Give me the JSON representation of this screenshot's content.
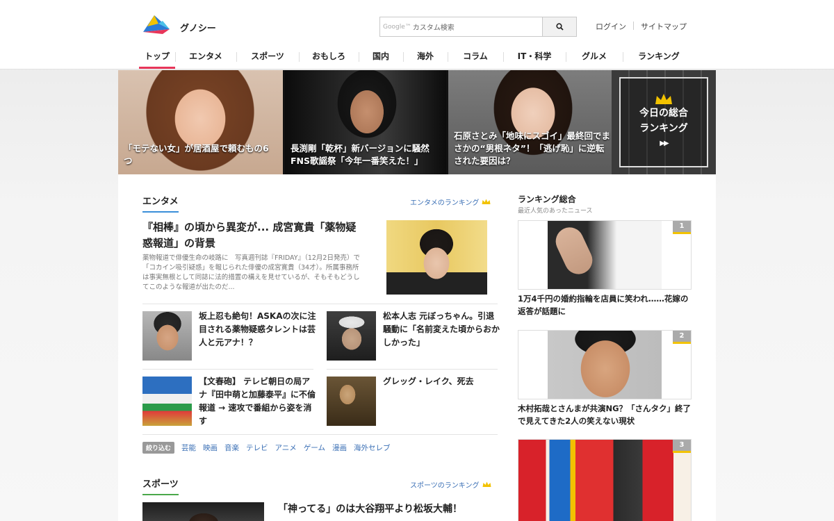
{
  "header": {
    "brand": "グノシー",
    "search_placeholder": "カスタム検索",
    "search_google_label": "Google™",
    "links": [
      "ログイン",
      "サイトマップ"
    ]
  },
  "nav": {
    "items": [
      "トップ",
      "エンタメ",
      "スポーツ",
      "おもしろ",
      "国内",
      "海外",
      "コラム",
      "IT・科学",
      "グルメ",
      "ランキング"
    ],
    "active": "トップ"
  },
  "hero": {
    "cards": [
      {
        "caption": "「モテない女」が居酒屋で頼むもの6つ"
      },
      {
        "caption": "長渕剛「乾杯」新バージョンに騒然 FNS歌謡祭「今年一番笑えた！」"
      },
      {
        "caption": "石原さとみ「地味にスゴイ」最終回でまさかの“男根ネタ”！「逃げ恥」に逆転された要因は？"
      }
    ],
    "ranking_box": {
      "line1": "今日の総合",
      "line2": "ランキング",
      "arrow": "▶▶"
    }
  },
  "entame": {
    "title": "エンタメ",
    "ranking_link": "エンタメのランキング",
    "main": {
      "headline": "『相棒』の頃から異変が... 成宮寛貴「薬物疑惑報道」の背景",
      "summary": "薬物報道で俳優生命の岐路に　写真週刊誌『FRIDAY』（12月2日発売）で「コカイン吸引疑惑」を報じられた俳優の成宮寛貴（34才）。所属事務所は事実無根として同誌に法的措置の構えを見せているが、そもそもどうしてこのような報道が出たのだ..."
    },
    "articles": [
      {
        "title": "坂上忍も絶句！ASKAの次に注目される薬物疑惑タレントは芸人と元アナ！？"
      },
      {
        "title": "松本人志 元ぼっちゃん。引退騒動に「名前変えた頃からおかしかった」"
      },
      {
        "title": "【文春砲】 テレビ朝日の局アナ『田中萌と加藤泰平』に不倫報道 → 速攻で番組から姿を消す"
      },
      {
        "title": "グレッグ・レイク、死去"
      }
    ],
    "filter_label": "絞り込む",
    "tags": [
      "芸能",
      "映画",
      "音楽",
      "テレビ",
      "アニメ",
      "ゲーム",
      "漫画",
      "海外セレブ"
    ]
  },
  "sports": {
    "title": "スポーツ",
    "ranking_link": "スポーツのランキング",
    "headline": "「神ってる」のは大谷翔平より松坂大輔！"
  },
  "sidebar": {
    "title": "ランキング総合",
    "subtitle": "最近人気のあったニュース",
    "items": [
      {
        "rank": "1",
        "title": "1万4千円の婚約指輪を店員に笑われ……花嫁の返答が話題に"
      },
      {
        "rank": "2",
        "title": "木村拓哉とさんまが共演NG？「さんタク」終了で見えてきた2人の笑えない現状"
      },
      {
        "rank": "3",
        "title": ""
      }
    ]
  },
  "colors": {
    "accent": "#e8365a",
    "link": "#3a6fb5",
    "entame_line": "#3a8fd9",
    "sports_line": "#4aa84a",
    "crown": "#f2c200"
  }
}
